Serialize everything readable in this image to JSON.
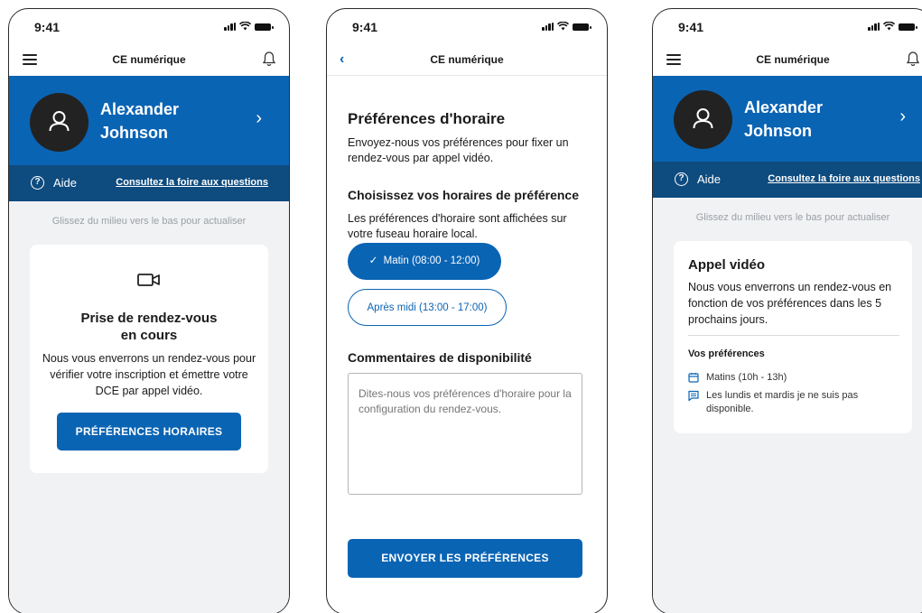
{
  "status": {
    "time": "9:41"
  },
  "app_title": "CE numérique",
  "profile": {
    "first_name": "Alexander",
    "last_name": "Johnson"
  },
  "help": {
    "label": "Aide",
    "faq_link": "Consultez la foire aux questions"
  },
  "refresh_hint": "Glissez du milieu vers le bas pour actualiser",
  "screen1": {
    "card_title_line1": "Prise de rendez-vous",
    "card_title_line2": "en cours",
    "card_body": "Nous vous enverrons un rendez-vous pour vérifier votre inscription et émettre votre DCE par appel vidéo.",
    "button": "PRÉFÉRENCES HORAIRES"
  },
  "screen2": {
    "title": "Préférences d'horaire",
    "intro": "Envoyez-nous vos préférences pour fixer un rendez-vous par appel vidéo.",
    "choose_heading": "Choisissez vos horaires de préférence",
    "choose_note": "Les préférences d'horaire sont affichées sur votre fuseau horaire local.",
    "options": [
      {
        "label": "Matin (08:00 - 12:00)",
        "selected": true
      },
      {
        "label": "Après midi (13:00 - 17:00)",
        "selected": false
      }
    ],
    "comments_heading": "Commentaires de disponibilité",
    "comments_placeholder": "Dites-nous vos préférences d'horaire pour la configuration du rendez-vous.",
    "submit": "ENVOYER LES PRÉFÉRENCES"
  },
  "screen3": {
    "card_title": "Appel vidéo",
    "card_body": "Nous vous enverrons un rendez-vous en fonction de vos préférences dans les 5 prochains jours.",
    "prefs_heading": "Vos préférences",
    "prefs": [
      {
        "icon": "calendar-icon",
        "text": "Matins (10h - 13h)"
      },
      {
        "icon": "comment-icon",
        "text": "Les lundis et mardis je ne suis pas disponible."
      }
    ]
  },
  "colors": {
    "primary": "#0a64b4",
    "help_bar": "#0e4b7e",
    "background": "#f1f2f4"
  }
}
